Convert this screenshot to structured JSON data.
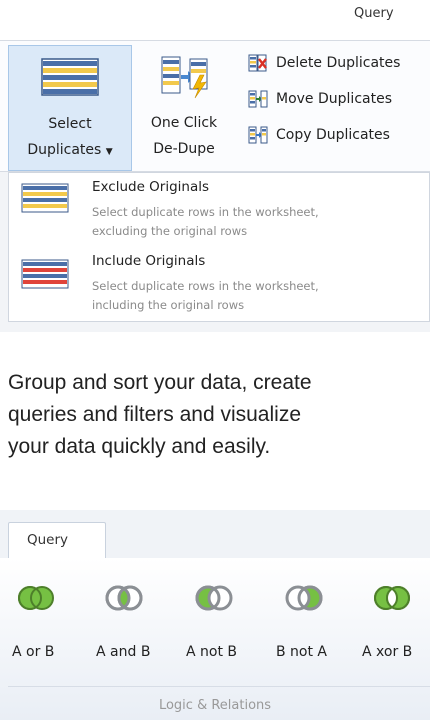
{
  "top_ribbon": {
    "tab_label": "Query",
    "select_duplicates": {
      "line1": "Select",
      "line2": "Duplicates"
    },
    "one_click": {
      "line1": "One Click",
      "line2": "De-Dupe"
    },
    "small_buttons": [
      {
        "label": "Delete Duplicates",
        "icon": "delete-duplicates-icon"
      },
      {
        "label": "Move Duplicates",
        "icon": "move-duplicates-icon"
      },
      {
        "label": "Copy Duplicates",
        "icon": "copy-duplicates-icon"
      }
    ],
    "dropdown": [
      {
        "title": "Exclude Originals",
        "desc1": "Select duplicate rows in the worksheet,",
        "desc2": "excluding the original rows"
      },
      {
        "title": "Include Originals",
        "desc1": "Select duplicate rows in the worksheet,",
        "desc2": "including the original rows"
      }
    ]
  },
  "description": {
    "line1": "Group and sort your data, create",
    "line2": "queries and filters and visualize",
    "line3": "your data quickly and easily."
  },
  "bottom_ribbon": {
    "tab_label": "Query",
    "group_label": "Logic & Relations",
    "buttons": [
      {
        "label": "A or B",
        "icon": "venn-a-or-b-icon"
      },
      {
        "label": "A and B",
        "icon": "venn-a-and-b-icon"
      },
      {
        "label": "A not B",
        "icon": "venn-a-not-b-icon"
      },
      {
        "label": "B not A",
        "icon": "venn-b-not-a-icon"
      },
      {
        "label": "A xor B",
        "icon": "venn-a-xor-b-icon"
      }
    ]
  },
  "colors": {
    "accent_green": "#76c043",
    "venn_gray": "#9aa0a6",
    "ribbon_selected": "#dbe9f8"
  }
}
